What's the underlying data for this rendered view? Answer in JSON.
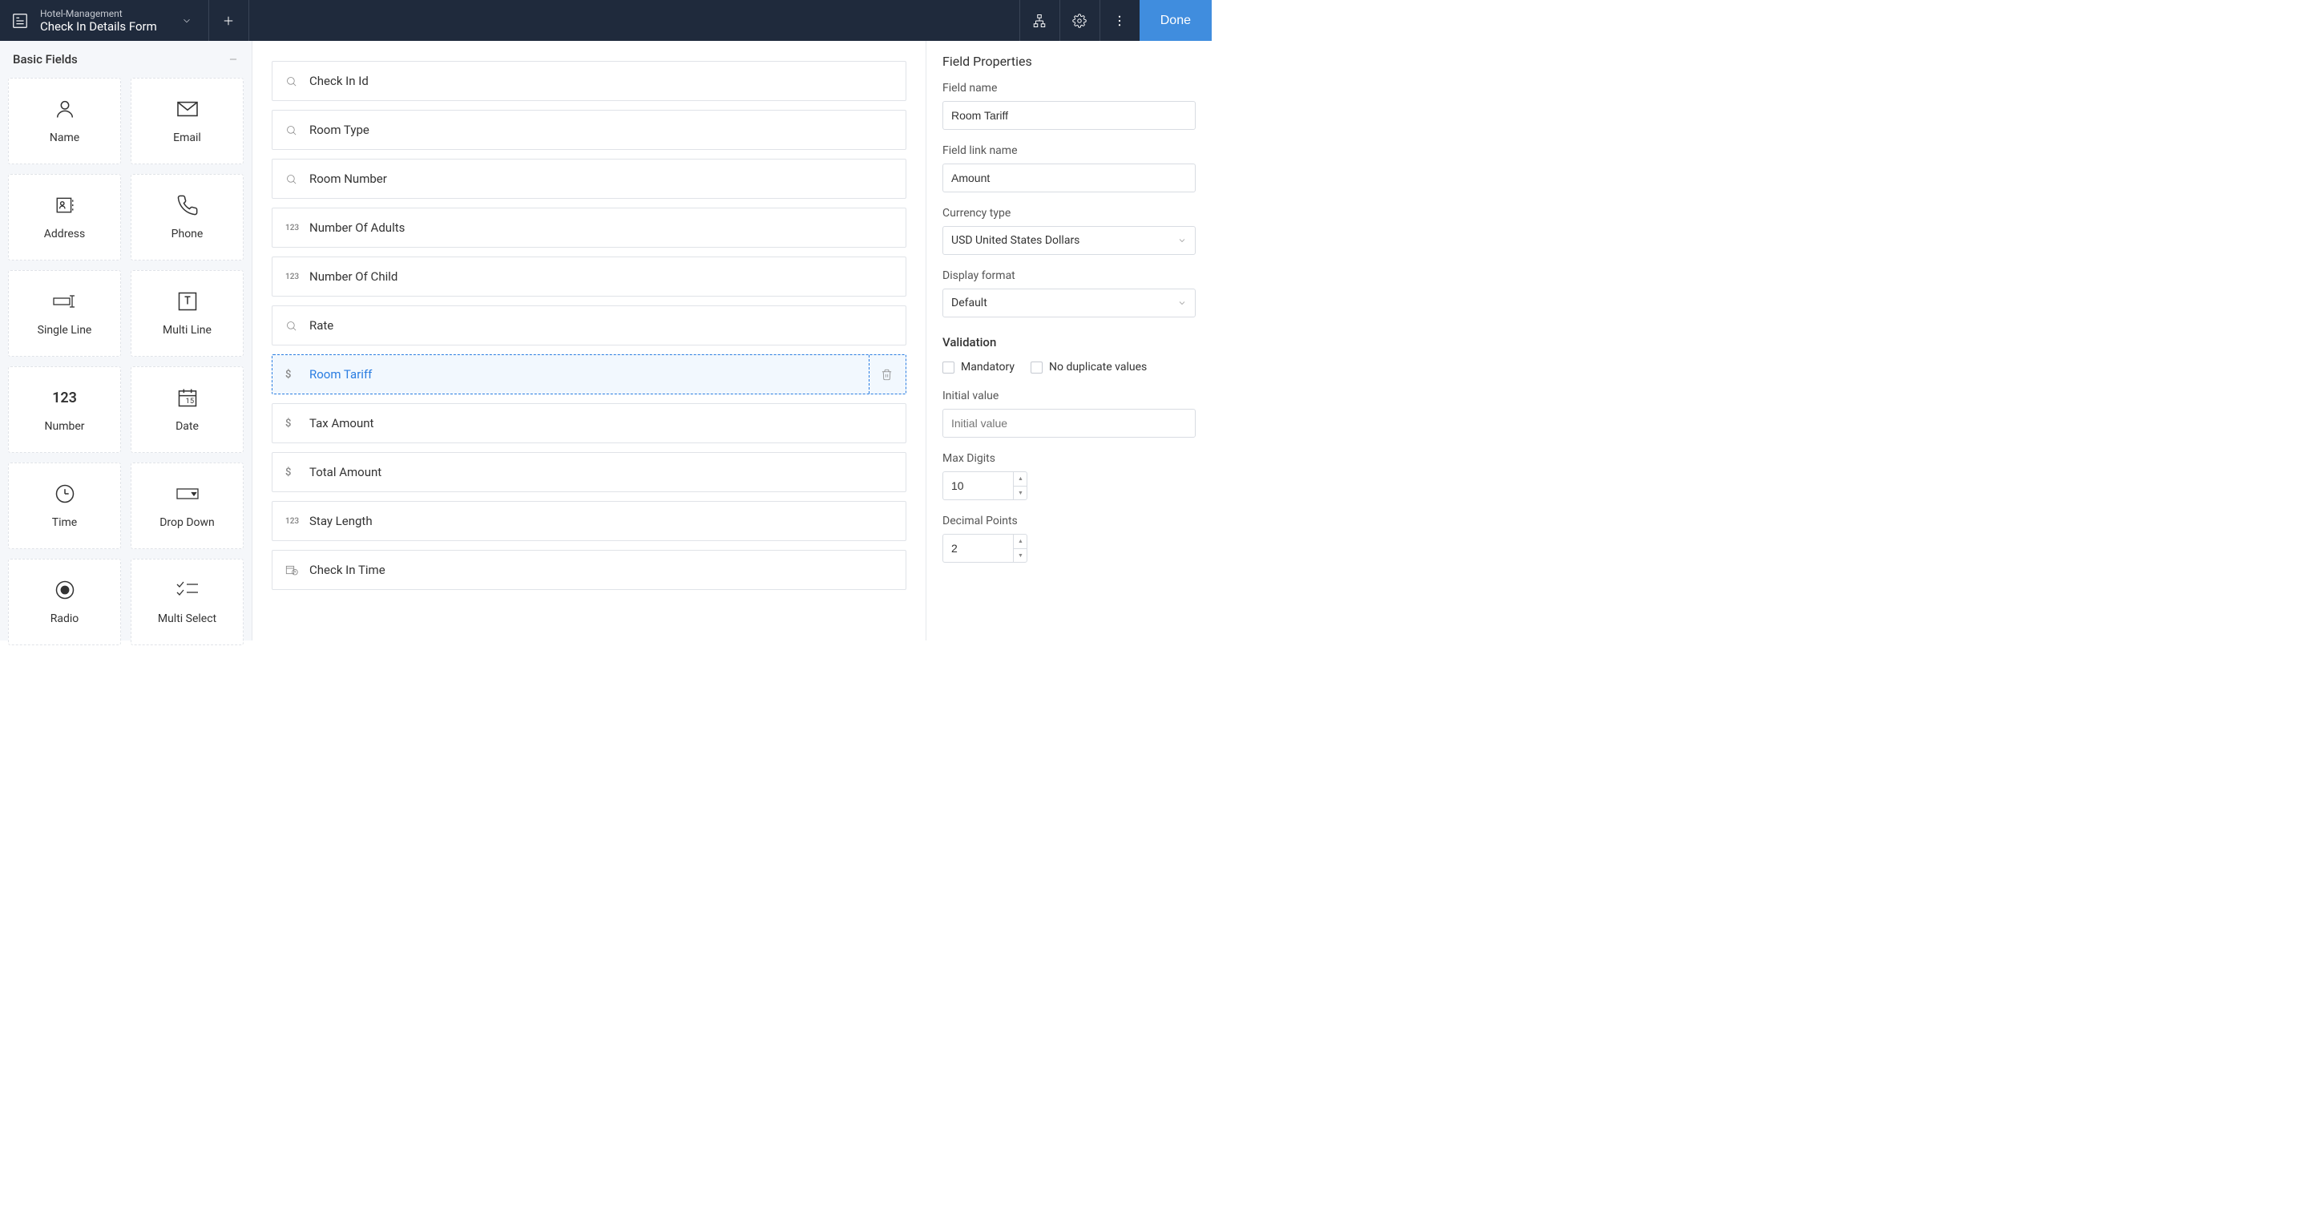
{
  "header": {
    "app_name": "Hotel-Management",
    "form_name": "Check In Details Form",
    "done_label": "Done"
  },
  "sidebar": {
    "section_title": "Basic Fields",
    "fields": [
      {
        "label": "Name",
        "icon": "user"
      },
      {
        "label": "Email",
        "icon": "mail"
      },
      {
        "label": "Address",
        "icon": "address"
      },
      {
        "label": "Phone",
        "icon": "phone"
      },
      {
        "label": "Single Line",
        "icon": "single-line"
      },
      {
        "label": "Multi Line",
        "icon": "multi-line"
      },
      {
        "label": "Number",
        "icon": "number",
        "text_icon": "123"
      },
      {
        "label": "Date",
        "icon": "date"
      },
      {
        "label": "Time",
        "icon": "time"
      },
      {
        "label": "Drop Down",
        "icon": "dropdown"
      },
      {
        "label": "Radio",
        "icon": "radio"
      },
      {
        "label": "Multi Select",
        "icon": "multi-select"
      }
    ]
  },
  "canvas": {
    "fields": [
      {
        "label": "Check In Id",
        "type": "lookup",
        "selected": false
      },
      {
        "label": "Room Type",
        "type": "lookup",
        "selected": false
      },
      {
        "label": "Room Number",
        "type": "lookup",
        "selected": false
      },
      {
        "label": "Number Of Adults",
        "type": "number",
        "selected": false
      },
      {
        "label": "Number Of Child",
        "type": "number",
        "selected": false
      },
      {
        "label": "Rate",
        "type": "lookup",
        "selected": false
      },
      {
        "label": "Room Tariff",
        "type": "currency",
        "selected": true
      },
      {
        "label": "Tax Amount",
        "type": "currency",
        "selected": false
      },
      {
        "label": "Total Amount",
        "type": "currency",
        "selected": false
      },
      {
        "label": "Stay Length",
        "type": "number",
        "selected": false
      },
      {
        "label": "Check In Time",
        "type": "datetime",
        "selected": false
      }
    ]
  },
  "properties": {
    "panel_title": "Field Properties",
    "field_name_label": "Field name",
    "field_name_value": "Room Tariff",
    "field_link_label": "Field link name",
    "field_link_value": "Amount",
    "currency_type_label": "Currency type",
    "currency_type_value": "USD United States Dollars",
    "display_format_label": "Display format",
    "display_format_value": "Default",
    "validation_title": "Validation",
    "mandatory_label": "Mandatory",
    "no_dup_label": "No duplicate values",
    "initial_value_label": "Initial value",
    "initial_value_placeholder": "Initial value",
    "initial_value_value": "",
    "max_digits_label": "Max Digits",
    "max_digits_value": "10",
    "decimal_points_label": "Decimal Points",
    "decimal_points_value": "2"
  }
}
